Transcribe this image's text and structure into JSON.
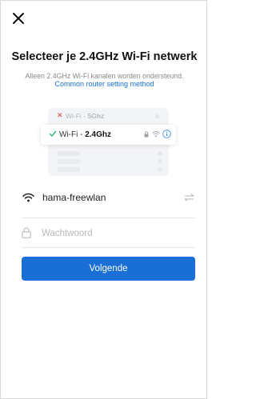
{
  "header": {
    "close_icon": "close-icon",
    "title": "Selecteer je 2.4GHz Wi-Fi netwerk",
    "subtitle": "Alleen 2.4GHz Wi-Fi kanalen worden ondersteund.",
    "help_link": "Common router setting method"
  },
  "illustration": {
    "bad_network_prefix": "Wi-Fi - ",
    "bad_network_band": "5Ghz",
    "good_network_prefix": "Wi-Fi - ",
    "good_network_band": "2.4Ghz",
    "colors": {
      "bad": "#e23b3b",
      "good": "#2bb673",
      "info": "#3b8be8"
    }
  },
  "form": {
    "ssid_value": "hama-freewlan",
    "password_placeholder": "Wachtwoord",
    "next_label": "Volgende"
  },
  "colors": {
    "accent": "#1a6fd6"
  }
}
